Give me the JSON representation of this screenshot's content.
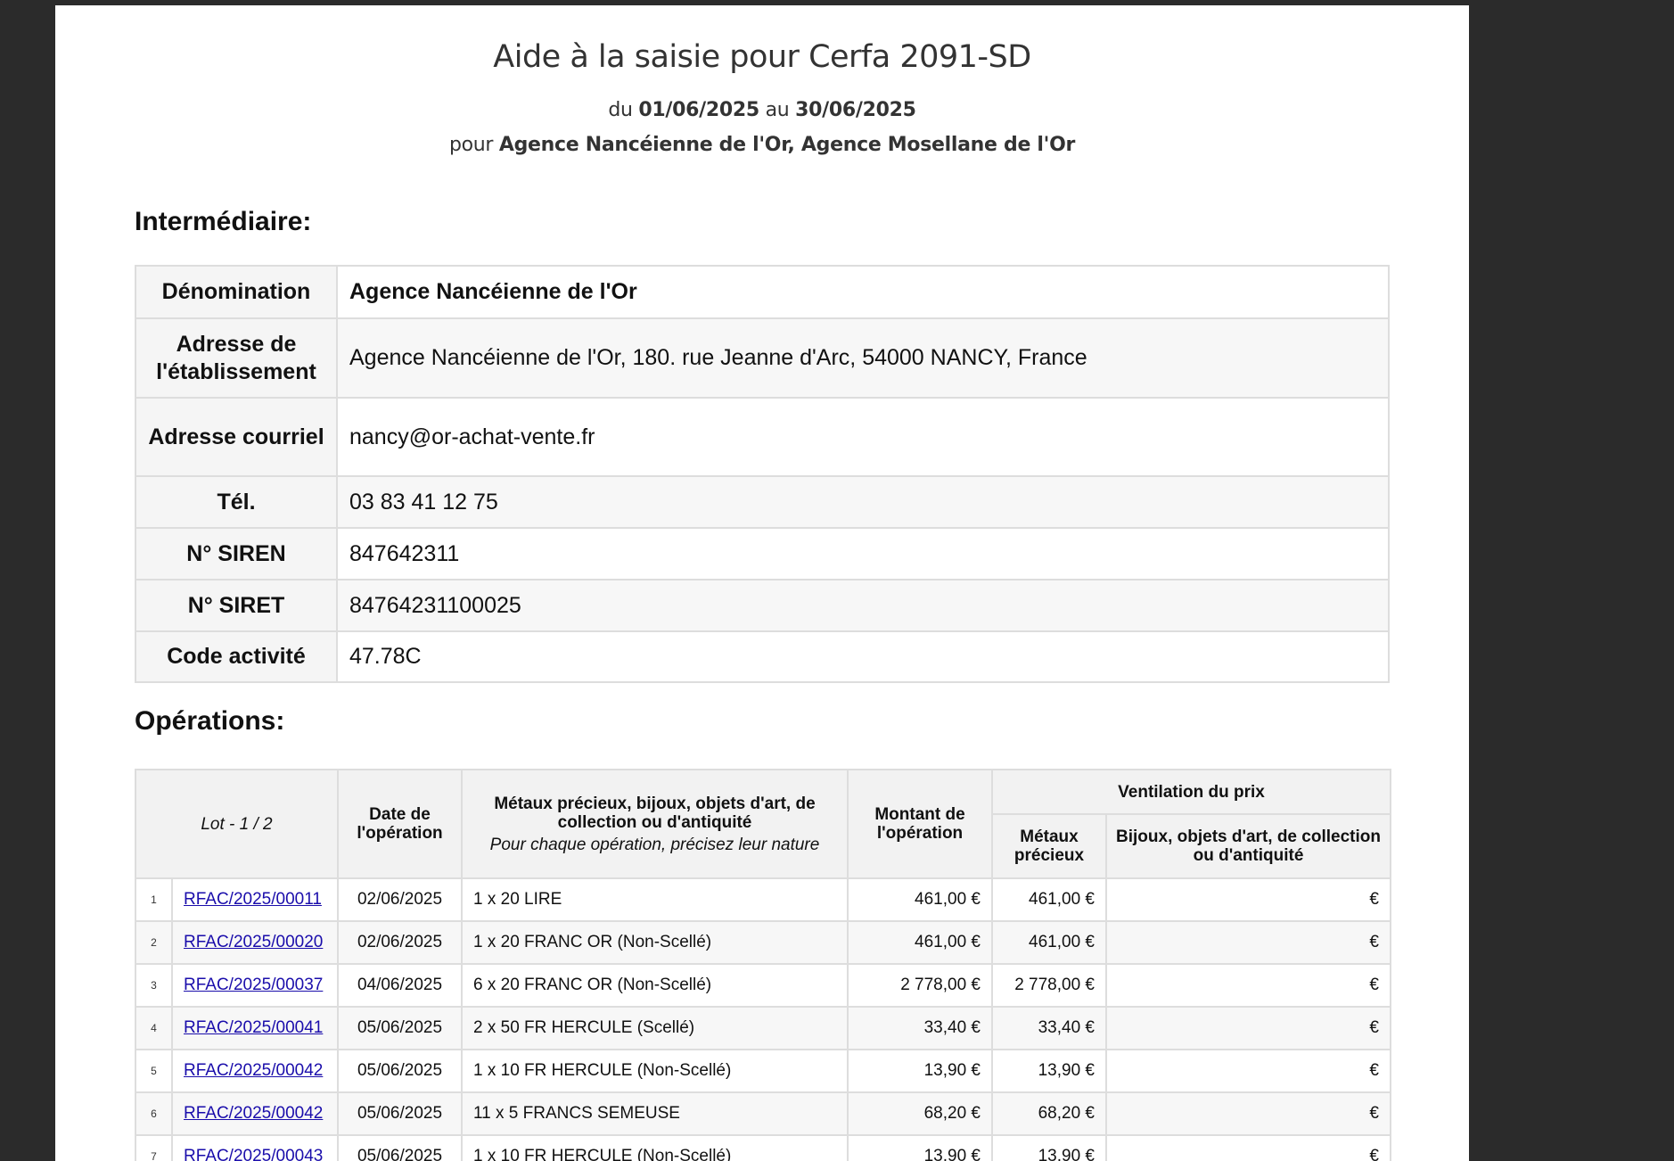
{
  "header": {
    "title": "Aide à la saisie pour Cerfa 2091-SD",
    "period_prefix": "du",
    "period_start": "01/06/2025",
    "period_mid": "au",
    "period_end": "30/06/2025",
    "for_prefix": "pour",
    "for_entities": "Agence Nancéienne de l'Or, Agence Mosellane de l'Or"
  },
  "intermediaire": {
    "heading": "Intermédiaire:",
    "rows": [
      {
        "label": "Dénomination",
        "value": "Agence Nancéienne de l'Or"
      },
      {
        "label": "Adresse de l'établissement",
        "value": "Agence Nancéienne de l'Or, 180. rue Jeanne d'Arc, 54000 NANCY, France"
      },
      {
        "label": "Adresse courriel",
        "value": "nancy@or-achat-vente.fr"
      },
      {
        "label": "Tél.",
        "value": "03 83 41 12 75"
      },
      {
        "label": "N° SIREN",
        "value": "847642311"
      },
      {
        "label": "N° SIRET",
        "value": "84764231100025"
      },
      {
        "label": "Code activité",
        "value": "47.78C"
      }
    ]
  },
  "operations": {
    "heading": "Opérations:",
    "headers": {
      "lot": "Lot - 1 / 2",
      "date": "Date de l'opération",
      "metaux_title": "Métaux précieux, bijoux, objets d'art, de collection ou d'antiquité",
      "metaux_note": "Pour chaque opération, précisez leur nature",
      "montant": "Montant de l'opération",
      "ventilation": "Ventilation du prix",
      "metaux_precieux": "Métaux précieux",
      "bijoux": "Bijoux, objets d'art, de collection ou d'antiquité"
    },
    "rows": [
      {
        "num": "1",
        "ref": "RFAC/2025/00011",
        "date": "02/06/2025",
        "nature": "1 x 20 LIRE",
        "montant": "461,00 €",
        "metaux": "461,00 €",
        "bijoux": "€"
      },
      {
        "num": "2",
        "ref": "RFAC/2025/00020",
        "date": "02/06/2025",
        "nature": "1 x 20 FRANC OR (Non-Scellé)",
        "montant": "461,00 €",
        "metaux": "461,00 €",
        "bijoux": "€"
      },
      {
        "num": "3",
        "ref": "RFAC/2025/00037",
        "date": "04/06/2025",
        "nature": "6 x 20 FRANC OR (Non-Scellé)",
        "montant": "2 778,00 €",
        "metaux": "2 778,00 €",
        "bijoux": "€"
      },
      {
        "num": "4",
        "ref": "RFAC/2025/00041",
        "date": "05/06/2025",
        "nature": "2 x 50 FR HERCULE (Scellé)",
        "montant": "33,40 €",
        "metaux": "33,40 €",
        "bijoux": "€"
      },
      {
        "num": "5",
        "ref": "RFAC/2025/00042",
        "date": "05/06/2025",
        "nature": "1 x 10 FR HERCULE (Non-Scellé)",
        "montant": "13,90 €",
        "metaux": "13,90 €",
        "bijoux": "€"
      },
      {
        "num": "6",
        "ref": "RFAC/2025/00042",
        "date": "05/06/2025",
        "nature": "11 x 5 FRANCS SEMEUSE",
        "montant": "68,20 €",
        "metaux": "68,20 €",
        "bijoux": "€"
      },
      {
        "num": "7",
        "ref": "RFAC/2025/00043",
        "date": "05/06/2025",
        "nature": "1 x 10 FR HERCULE (Non-Scellé)",
        "montant": "13,90 €",
        "metaux": "13,90 €",
        "bijoux": "€"
      }
    ]
  }
}
